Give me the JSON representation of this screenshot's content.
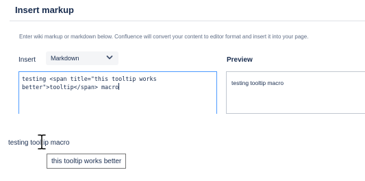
{
  "dialog": {
    "title": "Insert markup",
    "hint": "Enter wiki markup or markdown below. Confluence will convert your content to editor format and insert it into your page."
  },
  "insert": {
    "label": "Insert",
    "selected_format": "Markdown",
    "chevron_icon": "chevron-down-icon"
  },
  "editor": {
    "content": "testing <span title=\"this tooltip works better\">tooltip</span> macro"
  },
  "preview": {
    "label": "Preview",
    "content": "testing tooltip macro"
  },
  "rendered_page": {
    "prefix": "testing ",
    "tooltip_word": "tooltip",
    "suffix": " macro",
    "cursor_icon": "text-cursor-icon"
  },
  "tooltip": {
    "text": "this tooltip works better"
  },
  "colors": {
    "focus_border": "#4c9aff",
    "text": "#172b4d",
    "muted": "#5e6c84",
    "select_bg": "#f4f5f7"
  }
}
